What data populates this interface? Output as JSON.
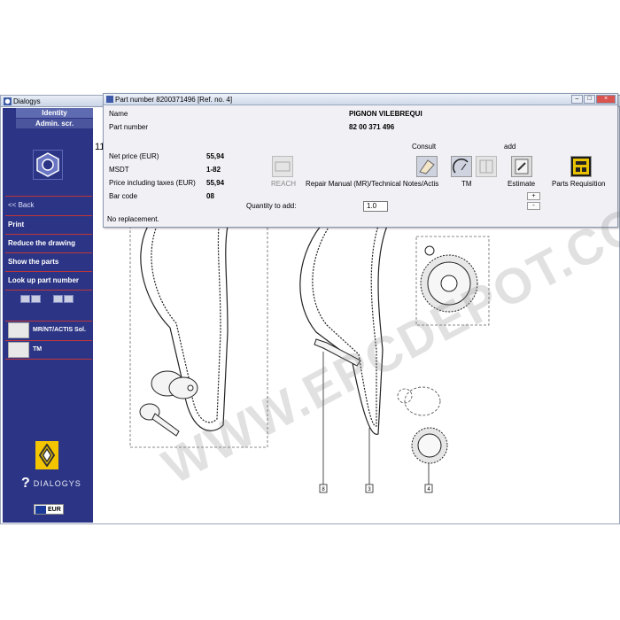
{
  "app": {
    "title": "Dialogys"
  },
  "sidebar": {
    "tabs": [
      "Identity",
      "Admin. scr."
    ],
    "links": {
      "back": "<< Back",
      "print": "Print",
      "reduce": "Reduce the drawing",
      "show_parts": "Show the parts",
      "lookup": "Look up part number"
    },
    "tools": {
      "mr": "MR/NT/ACTIS Sol.",
      "tm": "TM"
    },
    "brand": "DIALOGYS",
    "currency": "EUR"
  },
  "main": {
    "page_number": "11"
  },
  "dialog": {
    "title": "Part number 8200371496 [Ref. no. 4]",
    "name_label": "Name",
    "name_value": "PIGNON VILEBREQUI",
    "part_label": "Part number",
    "part_value": "82 00 371 496",
    "net_price_label": "Net price (EUR)",
    "net_price_value": "55,94",
    "msdt_label": "MSDT",
    "msdt_value": "1-82",
    "price_tax_label": "Price including taxes (EUR)",
    "price_tax_value": "55,94",
    "barcode_label": "Bar code",
    "barcode_value": "08",
    "qty_label": "Quantity to add:",
    "qty_value": "1.0",
    "no_replacement": "No replacement.",
    "consult_label": "Consult",
    "add_label": "add",
    "reach": "REACH",
    "repair_manual": "Repair Manual (MR)/Technical Notes/Actis",
    "tm": "TM",
    "estimate": "Estimate",
    "parts_requisition": "Parts Requisition",
    "plus": "+",
    "minus": "-"
  },
  "callouts": [
    "8",
    "3",
    "4"
  ],
  "watermark": "WWW.EPCDEPOT.COM"
}
